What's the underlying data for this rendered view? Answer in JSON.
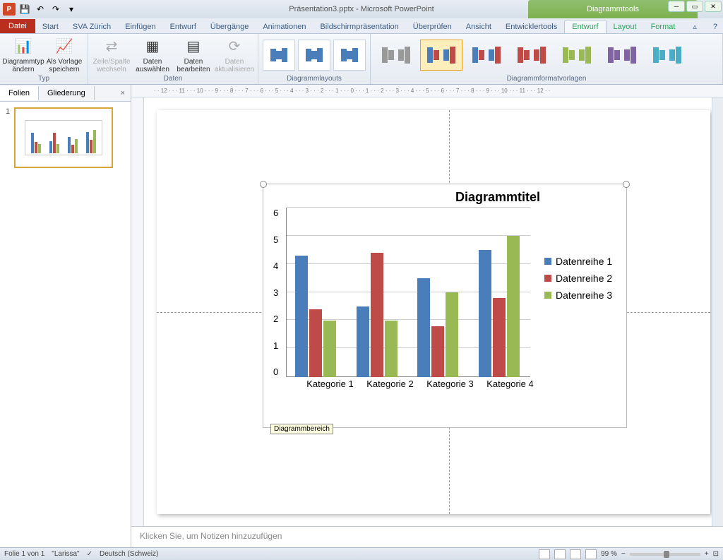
{
  "app": {
    "title": "Präsentation3.pptx - Microsoft PowerPoint",
    "contextual_tab_title": "Diagrammtools"
  },
  "qat": {
    "save": "💾",
    "undo": "↶",
    "redo": "↷",
    "dropdown": "▾"
  },
  "tabs": {
    "file": "Datei",
    "start": "Start",
    "sva": "SVA Zürich",
    "insert": "Einfügen",
    "design": "Entwurf",
    "transitions": "Übergänge",
    "animations": "Animationen",
    "slideshow": "Bildschirmpräsentation",
    "review": "Überprüfen",
    "view": "Ansicht",
    "developer": "Entwicklertools",
    "chart_design": "Entwurf",
    "chart_layout": "Layout",
    "chart_format": "Format"
  },
  "ribbon": {
    "type": {
      "change_type": "Diagrammtyp\nändern",
      "save_template": "Als Vorlage\nspeichern",
      "label": "Typ"
    },
    "data": {
      "switch": "Zeile/Spalte\nwechseln",
      "select": "Daten\nauswählen",
      "edit": "Daten\nbearbeiten",
      "refresh": "Daten\naktualisieren",
      "label": "Daten"
    },
    "layouts": {
      "label": "Diagrammlayouts"
    },
    "styles": {
      "label": "Diagrammformatvorlagen"
    }
  },
  "panel": {
    "slides": "Folien",
    "outline": "Gliederung",
    "thumb_num": "1"
  },
  "chart_data": {
    "type": "bar",
    "title": "Diagrammtitel",
    "categories": [
      "Kategorie 1",
      "Kategorie 2",
      "Kategorie 3",
      "Kategorie 4"
    ],
    "series": [
      {
        "name": "Datenreihe 1",
        "values": [
          4.3,
          2.5,
          3.5,
          4.5
        ],
        "color": "#4a7ebb"
      },
      {
        "name": "Datenreihe 2",
        "values": [
          2.4,
          4.4,
          1.8,
          2.8
        ],
        "color": "#be4b48"
      },
      {
        "name": "Datenreihe 3",
        "values": [
          2.0,
          2.0,
          3.0,
          5.0
        ],
        "color": "#98b954"
      }
    ],
    "ylim": [
      0,
      6
    ],
    "yticks": [
      "0",
      "1",
      "2",
      "3",
      "4",
      "5",
      "6"
    ],
    "tooltip": "Diagrammbereich"
  },
  "notes": {
    "placeholder": "Klicken Sie, um Notizen hinzuzufügen"
  },
  "status": {
    "slide": "Folie 1 von 1",
    "theme": "\"Larissa\"",
    "lang": "Deutsch (Schweiz)",
    "zoom": "99 %",
    "minus": "−",
    "plus": "+"
  },
  "ruler_marks": "· · 12 · · · 11 · · · 10 · · · 9 · · · 8 · · · 7 · · · 6 · · · 5 · · · 4 · · · 3 · · · 2 · · · 1 · · · 0 · · · 1 · · · 2 · · · 3 · · · 4 · · · 5 · · · 6 · · · 7 · · · 8 · · · 9 · · · 10 · · · 11 · · · 12 · ·"
}
